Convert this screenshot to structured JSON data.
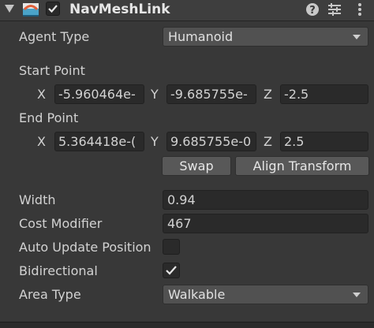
{
  "component": {
    "title": "NavMeshLink",
    "enabled": true,
    "icon": "navmesh-link-icon",
    "help_icon": "help-icon",
    "preset_icon": "preset-icon",
    "menu_icon": "kebab-menu-icon"
  },
  "agent_type": {
    "label": "Agent Type",
    "value": "Humanoid"
  },
  "start_point": {
    "label": "Start Point",
    "x_label": "X",
    "x": "-5.960464e-",
    "y_label": "Y",
    "y": "-9.685755e-",
    "z_label": "Z",
    "z": "-2.5"
  },
  "end_point": {
    "label": "End Point",
    "x_label": "X",
    "x": "5.364418e-(",
    "y_label": "Y",
    "y": "9.685755e-0",
    "z_label": "Z",
    "z": "2.5"
  },
  "buttons": {
    "swap": "Swap",
    "align_transform": "Align Transform"
  },
  "width": {
    "label": "Width",
    "value": "0.94"
  },
  "cost_modifier": {
    "label": "Cost Modifier",
    "value": "467"
  },
  "auto_update_position": {
    "label": "Auto Update Position",
    "checked": false
  },
  "bidirectional": {
    "label": "Bidirectional",
    "checked": true
  },
  "area_type": {
    "label": "Area Type",
    "value": "Walkable"
  },
  "colors": {
    "background": "#383838",
    "field": "#2a2a2a",
    "button": "#585858",
    "text": "#d2d2d2"
  }
}
